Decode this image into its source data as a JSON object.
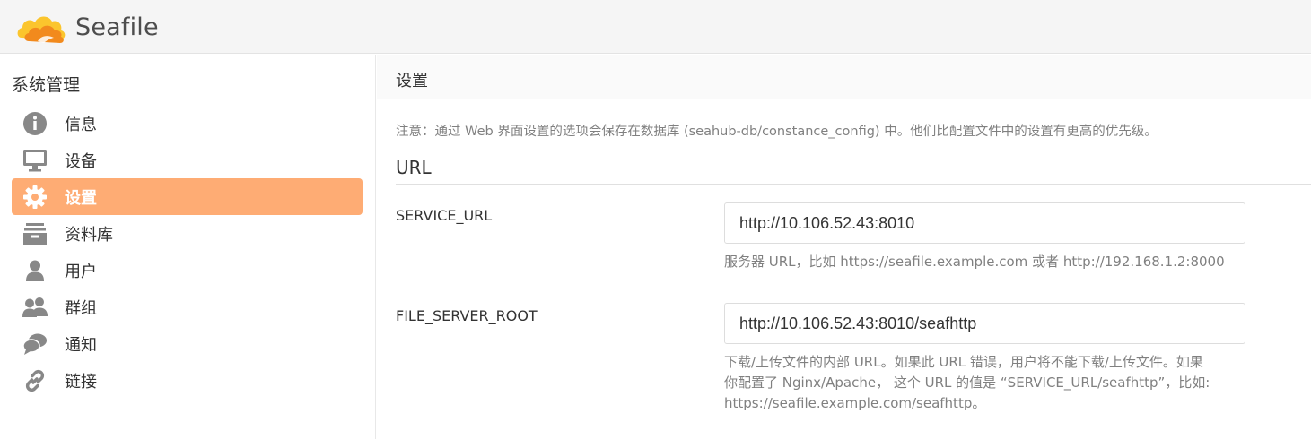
{
  "header": {
    "logo_text": "Seafile"
  },
  "sidebar": {
    "title": "系统管理",
    "items": [
      {
        "label": "信息",
        "icon": "info-icon"
      },
      {
        "label": "设备",
        "icon": "monitor-icon"
      },
      {
        "label": "设置",
        "icon": "gear-icon",
        "active": true
      },
      {
        "label": "资料库",
        "icon": "archive-icon"
      },
      {
        "label": "用户",
        "icon": "user-icon"
      },
      {
        "label": "群组",
        "icon": "group-icon"
      },
      {
        "label": "通知",
        "icon": "chat-icon"
      },
      {
        "label": "链接",
        "icon": "link-icon"
      }
    ]
  },
  "main": {
    "title": "设置",
    "notice": "注意：通过 Web 界面设置的选项会保存在数据库 (seahub-db/constance_config) 中。他们比配置文件中的设置有更高的优先级。",
    "section": "URL",
    "fields": [
      {
        "label": "SERVICE_URL",
        "value": "http://10.106.52.43:8010",
        "help_lines": [
          "服务器 URL，比如 https://seafile.example.com 或者 http://192.168.1.2:8000"
        ]
      },
      {
        "label": "FILE_SERVER_ROOT",
        "value": "http://10.106.52.43:8010/seafhttp",
        "help_lines": [
          "下载/上传文件的内部 URL。如果此 URL 错误，用户将不能下载/上传文件。如果",
          "你配置了 Nginx/Apache， 这个 URL 的值是 “SERVICE_URL/seafhttp”，比如:",
          "https://seafile.example.com/seafhttp。"
        ]
      }
    ]
  },
  "colors": {
    "accent": "#feac74",
    "icon_gray": "#888888",
    "logo_orange": "#f7a823"
  }
}
